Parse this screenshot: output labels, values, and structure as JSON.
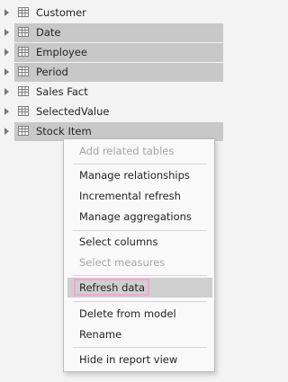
{
  "tables": [
    {
      "label": "Customer",
      "highlighted": false
    },
    {
      "label": "Date",
      "highlighted": true
    },
    {
      "label": "Employee",
      "highlighted": true
    },
    {
      "label": "Period",
      "highlighted": true
    },
    {
      "label": "Sales Fact",
      "highlighted": false
    },
    {
      "label": "SelectedValue",
      "highlighted": false
    },
    {
      "label": "Stock Item",
      "highlighted": true
    }
  ],
  "menu": {
    "add_related": "Add related tables",
    "manage_relationships": "Manage relationships",
    "incremental_refresh": "Incremental refresh",
    "manage_aggregations": "Manage aggregations",
    "select_columns": "Select columns",
    "select_measures": "Select measures",
    "refresh_data": "Refresh data",
    "delete_from_model": "Delete from model",
    "rename": "Rename",
    "hide_in_report_view": "Hide in report view"
  },
  "colors": {
    "row_highlight": "#c8c8c8",
    "hover_item": "#cfcfcf",
    "callout_border": "#f2a7d0",
    "disabled_text": "#a6a6a6"
  },
  "icons": {
    "expand": "chevron-right-icon",
    "table": "table-icon"
  }
}
